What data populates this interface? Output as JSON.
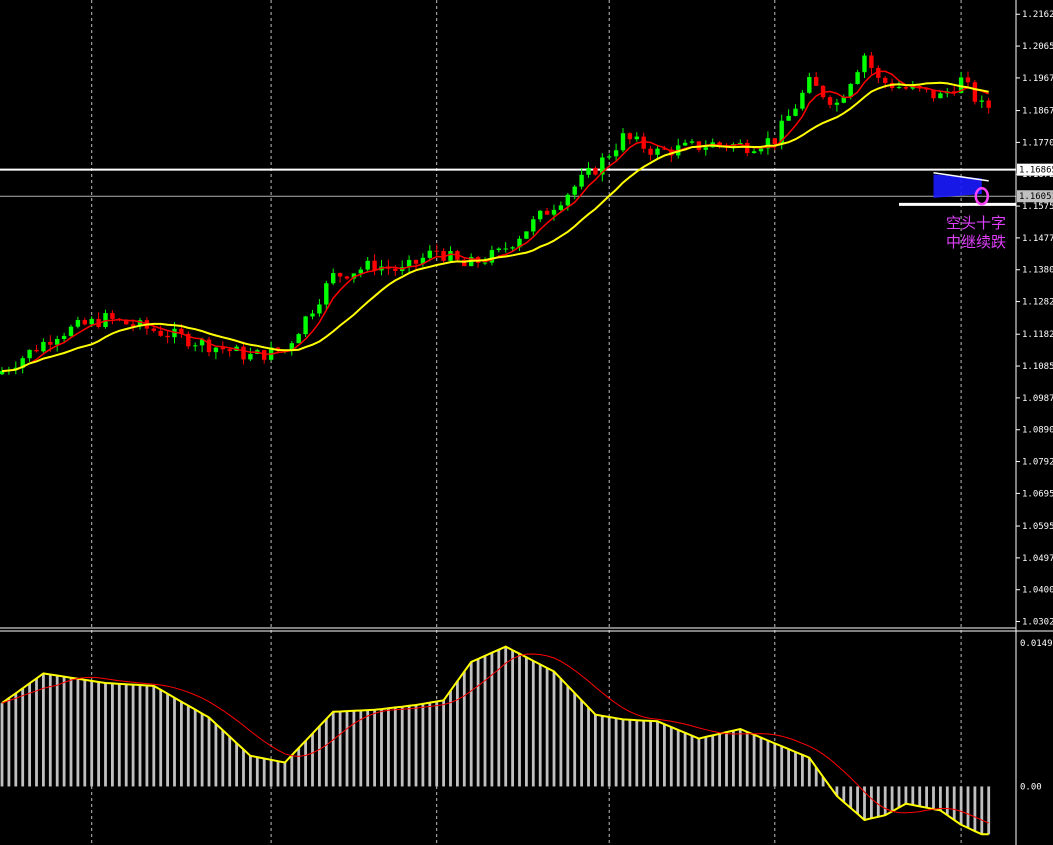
{
  "chart_data": [
    {
      "type": "candlestick",
      "panel": "price",
      "y_ticks": [
        "1.21625",
        "1.20650",
        "1.19675",
        "1.18675",
        "1.17700",
        "1.16725",
        "1.15750",
        "1.14775",
        "1.13800",
        "1.12825",
        "1.11825",
        "1.10850",
        "1.09875",
        "1.08900",
        "1.07925",
        "1.06950",
        "1.05950",
        "1.04975",
        "1.04000",
        "1.03025"
      ],
      "y_tick_values": [
        1.21625,
        1.2065,
        1.19675,
        1.18675,
        1.177,
        1.16725,
        1.1575,
        1.14775,
        1.138,
        1.12825,
        1.11825,
        1.1085,
        1.09875,
        1.089,
        1.07925,
        1.0695,
        1.0595,
        1.04975,
        1.04,
        1.03025
      ],
      "ylim": [
        1.0295,
        1.22
      ],
      "price_tags": [
        {
          "label": "1.16865",
          "value": 1.16865,
          "color": "#ffffff"
        },
        {
          "label": "1.16051",
          "value": 1.16051,
          "color": "#c0c0c0"
        }
      ],
      "horizontal_lines": [
        {
          "value": 1.16865,
          "color": "#ffffff"
        },
        {
          "value": 1.16051,
          "color": "#b0b0b0"
        },
        {
          "value": 1.158,
          "color": "#ffffff",
          "from_bar": 130
        }
      ],
      "anchor_bars": [
        0,
        8,
        15,
        22,
        30,
        36,
        41,
        48,
        54,
        58,
        63,
        67,
        72,
        80,
        86,
        90,
        95,
        103,
        108,
        112,
        117,
        121,
        125,
        127,
        131,
        136,
        139,
        142
      ],
      "anchor_closes": [
        1.107,
        1.1185,
        1.123,
        1.1195,
        1.115,
        1.1115,
        1.1135,
        1.136,
        1.1395,
        1.1375,
        1.144,
        1.139,
        1.143,
        1.158,
        1.169,
        1.1785,
        1.174,
        1.1765,
        1.176,
        1.178,
        1.195,
        1.189,
        1.204,
        1.196,
        1.1935,
        1.191,
        1.196,
        1.188
      ],
      "candles": [],
      "moving_averages": [
        {
          "color": "#ff0000",
          "period": 5
        },
        {
          "color": "#ffff00",
          "period": 14
        }
      ],
      "vertical_grid_bars": [
        13,
        39,
        63,
        88,
        112,
        139
      ],
      "annotation": {
        "line1": "空头十字",
        "line2": "中继续跌",
        "color": "#e040fb"
      }
    },
    {
      "type": "histogram",
      "panel": "macd",
      "y_ticks": [
        "0.014986",
        "0.00"
      ],
      "y_tick_values": [
        0.014986,
        0
      ],
      "ylim": [
        -0.0058,
        0.0155
      ],
      "bar_color": "#c0c0c0",
      "anchor_bars": [
        0,
        6,
        15,
        22,
        30,
        36,
        41,
        48,
        54,
        60,
        64,
        68,
        73,
        80,
        86,
        90,
        95,
        101,
        107,
        112,
        117,
        121,
        125,
        128,
        131,
        136,
        139,
        142
      ],
      "anchor_values": [
        0.0087,
        0.0118,
        0.0108,
        0.0105,
        0.0072,
        0.0032,
        0.0025,
        0.0078,
        0.008,
        0.0085,
        0.009,
        0.013,
        0.0146,
        0.012,
        0.0075,
        0.007,
        0.0068,
        0.005,
        0.006,
        0.0045,
        0.003,
        -0.001,
        -0.0035,
        -0.003,
        -0.0018,
        -0.0025,
        -0.004,
        -0.005
      ],
      "values": [],
      "signal_color": "#ff0000",
      "signal_period": 9,
      "zero_label": "0.00"
    }
  ],
  "colors": {
    "background": "#000000",
    "bull": "#00ff00",
    "bear": "#ff0000",
    "grid": "#ffffff",
    "highlight_box": "#1a1aff",
    "circle": "#ff44ff"
  }
}
